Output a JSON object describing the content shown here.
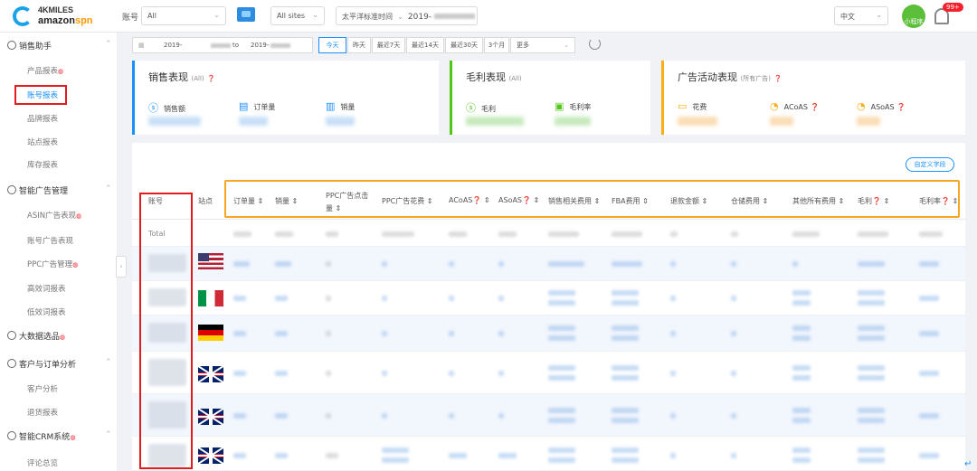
{
  "topbar": {
    "logo_line1": "4KMILES",
    "logo_line2a": "amazon",
    "logo_line2b": "spn",
    "account_label": "账号",
    "account_value": "All",
    "site_value": "All sites",
    "timezone_value": "太平洋标准时间",
    "date_value": "2019-",
    "language_value": "中文",
    "mini_program_label": "小程序",
    "notification_count": "99+"
  },
  "sidebar": {
    "groups": [
      {
        "label": "销售助手",
        "items": [
          {
            "label": "产品报表",
            "hot": true
          },
          {
            "label": "账号报表",
            "hot": false
          },
          {
            "label": "品牌报表",
            "hot": false
          },
          {
            "label": "站点报表",
            "hot": false
          },
          {
            "label": "库存报表",
            "hot": false
          }
        ]
      },
      {
        "label": "智能广告管理",
        "items": [
          {
            "label": "ASIN广告表现",
            "hot": true
          },
          {
            "label": "账号广告表现",
            "hot": false
          },
          {
            "label": "PPC广告管理",
            "hot": true
          },
          {
            "label": "高效词报表",
            "hot": false
          },
          {
            "label": "低效词报表",
            "hot": false
          }
        ]
      },
      {
        "label": "大数据选品",
        "hot": true,
        "items": []
      },
      {
        "label": "客户与订单分析",
        "items": [
          {
            "label": "客户分析",
            "hot": false
          },
          {
            "label": "退货报表",
            "hot": false
          }
        ]
      },
      {
        "label": "智能CRM系统",
        "hot": true,
        "items": [
          {
            "label": "评论总览",
            "hot": false
          }
        ]
      }
    ],
    "hot_glyph": "⚙"
  },
  "datebar": {
    "start": "2019-",
    "to": "to",
    "end": "2019-",
    "presets": [
      "今天",
      "昨天",
      "最近7天",
      "最近14天",
      "最近30天",
      "3个月",
      "更多"
    ],
    "active_preset": 0
  },
  "cards": {
    "sales": {
      "title": "销售表现",
      "scope": "(All)",
      "metrics": [
        "销售额",
        "订单量",
        "销量"
      ]
    },
    "profit": {
      "title": "毛利表现",
      "scope": "(All)",
      "metrics": [
        "毛利",
        "毛利率"
      ]
    },
    "ads": {
      "title": "广告活动表现",
      "scope": "(所有广告)",
      "metrics": [
        "花费",
        "ACoAS",
        "ASoAS"
      ]
    }
  },
  "table": {
    "custom_fields_button": "自定义字段",
    "columns": [
      "账号",
      "站点",
      "订单量",
      "销量",
      "PPC广告点击量",
      "PPC广告花费",
      "ACoAS",
      "ASoAS",
      "销售相关费用",
      "FBA费用",
      "退款金额",
      "仓储费用",
      "其他所有费用",
      "毛利",
      "毛利率"
    ],
    "total_label": "Total",
    "rows": [
      {
        "site": "US"
      },
      {
        "site": "IT"
      },
      {
        "site": "DE"
      },
      {
        "site": "UK"
      },
      {
        "site": "UK"
      },
      {
        "site": "UK"
      }
    ]
  },
  "colors": {
    "accent": "#1890ff",
    "highlight_red": "#e01c1c",
    "highlight_orange": "#f5a623",
    "sales_bar": "#1890ff",
    "profit_bar": "#52c41a",
    "ads_bar": "#faad14"
  }
}
